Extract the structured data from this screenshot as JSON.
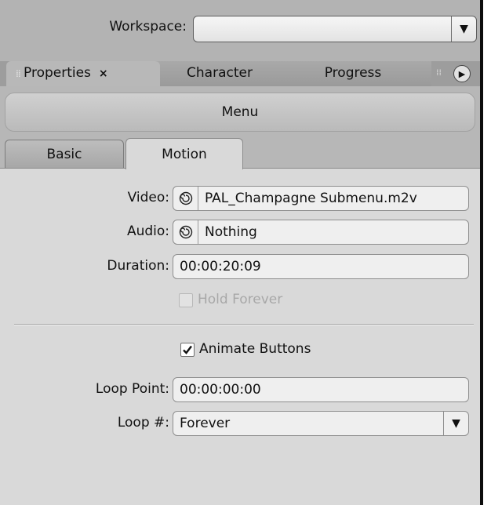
{
  "workspace": {
    "label": "Workspace:",
    "value": ""
  },
  "tabs": [
    {
      "label": "Properties",
      "active": true
    },
    {
      "label": "Character",
      "active": false
    },
    {
      "label": "Progress",
      "active": false
    }
  ],
  "properties": {
    "title": "Menu",
    "subtabs": [
      {
        "label": "Basic",
        "active": false
      },
      {
        "label": "Motion",
        "active": true
      }
    ],
    "video": {
      "label": "Video:",
      "value": "PAL_Champagne Submenu.m2v"
    },
    "audio": {
      "label": "Audio:",
      "value": "Nothing"
    },
    "duration": {
      "label": "Duration:",
      "value": "00:00:20:09"
    },
    "hold_forever": {
      "label": "Hold Forever",
      "checked": false,
      "enabled": false
    },
    "animate_buttons": {
      "label": "Animate Buttons",
      "checked": true
    },
    "loop_point": {
      "label": "Loop Point:",
      "value": "00:00:00:00"
    },
    "loop_count": {
      "label": "Loop #:",
      "value": "Forever"
    }
  }
}
